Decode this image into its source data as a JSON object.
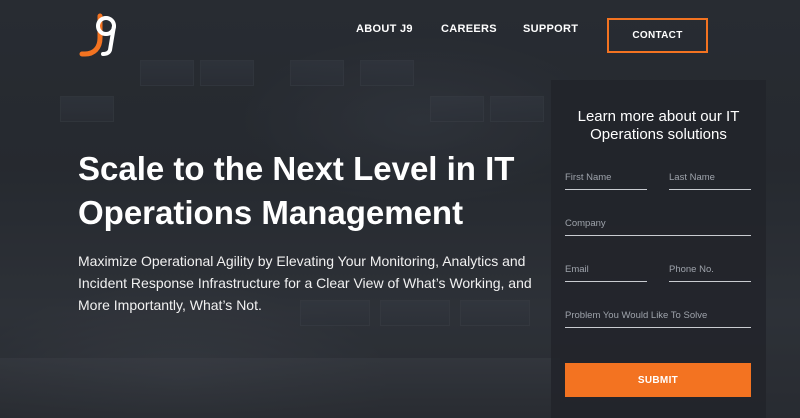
{
  "header": {
    "logo_text": "J9",
    "nav": [
      {
        "label": "ABOUT J9"
      },
      {
        "label": "CAREERS"
      },
      {
        "label": "SUPPORT"
      }
    ],
    "contact_label": "CONTACT"
  },
  "hero": {
    "headline": "Scale to the Next Level in IT Operations Management",
    "subtext": "Maximize Operational Agility by Elevating Your Monitoring, Analytics and Incident Response Infrastructure for a Clear View of What’s Working, and More Importantly, What’s Not."
  },
  "form": {
    "title": "Learn more about our IT Operations solutions",
    "first_name_placeholder": "First Name",
    "last_name_placeholder": "Last Name",
    "company_placeholder": "Company",
    "email_placeholder": "Email",
    "phone_placeholder": "Phone No.",
    "problem_placeholder": "Problem You Would Like To Solve",
    "submit_label": "SUBMIT"
  },
  "colors": {
    "accent": "#f37321",
    "panel": "#22252b",
    "background": "#2b2f36"
  }
}
